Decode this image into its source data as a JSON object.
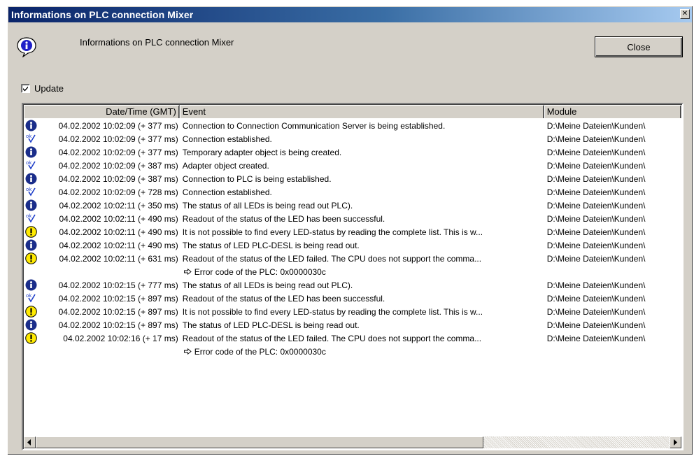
{
  "window": {
    "title": "Informations on PLC connection  Mixer"
  },
  "header": {
    "text": "Informations on PLC connection  Mixer",
    "close_label": "Close"
  },
  "update": {
    "label": "Update",
    "checked": true
  },
  "columns": [
    "Date/Time (GMT)",
    "Event",
    "Module"
  ],
  "rows": [
    {
      "icon": "info",
      "date": "04.02.2002 10:02:09 (+ 377 ms)",
      "event": "Connection to Connection Communication Server is being established.",
      "module": "D:\\Meine Dateien\\Kunden\\"
    },
    {
      "icon": "ok",
      "date": "04.02.2002 10:02:09 (+ 377 ms)",
      "event": "Connection established.",
      "module": "D:\\Meine Dateien\\Kunden\\"
    },
    {
      "icon": "info",
      "date": "04.02.2002 10:02:09 (+ 377 ms)",
      "event": "Temporary adapter object is being created.",
      "module": "D:\\Meine Dateien\\Kunden\\"
    },
    {
      "icon": "ok",
      "date": "04.02.2002 10:02:09 (+ 387 ms)",
      "event": "Adapter object created.",
      "module": "D:\\Meine Dateien\\Kunden\\"
    },
    {
      "icon": "info",
      "date": "04.02.2002 10:02:09 (+ 387 ms)",
      "event": "Connection to PLC is being established.",
      "module": "D:\\Meine Dateien\\Kunden\\"
    },
    {
      "icon": "ok",
      "date": "04.02.2002 10:02:09 (+ 728 ms)",
      "event": "Connection established.",
      "module": "D:\\Meine Dateien\\Kunden\\"
    },
    {
      "icon": "info",
      "date": "04.02.2002 10:02:11 (+ 350 ms)",
      "event": "The status of all LEDs is being read out PLC).",
      "module": "D:\\Meine Dateien\\Kunden\\"
    },
    {
      "icon": "ok",
      "date": "04.02.2002 10:02:11 (+ 490 ms)",
      "event": "Readout of the status of the LED has been successful.",
      "module": "D:\\Meine Dateien\\Kunden\\"
    },
    {
      "icon": "warn",
      "date": "04.02.2002 10:02:11 (+ 490 ms)",
      "event": "It is not possible to find every LED-status by reading the complete list. This is w...",
      "module": "D:\\Meine Dateien\\Kunden\\"
    },
    {
      "icon": "info",
      "date": "04.02.2002 10:02:11 (+ 490 ms)",
      "event": "The status of LED PLC-DESL is being read out.",
      "module": "D:\\Meine Dateien\\Kunden\\"
    },
    {
      "icon": "warn",
      "date": "04.02.2002 10:02:11 (+ 631 ms)",
      "event": "Readout of the status of the LED failed. The CPU does not support the comma...",
      "module": "D:\\Meine Dateien\\Kunden\\"
    },
    {
      "icon": "",
      "date": "",
      "event": "Error code of the PLC: 0x0000030c",
      "module": "",
      "sub": true
    },
    {
      "icon": "info",
      "date": "04.02.2002 10:02:15 (+ 777 ms)",
      "event": "The status of all LEDs is being read out PLC).",
      "module": "D:\\Meine Dateien\\Kunden\\"
    },
    {
      "icon": "ok",
      "date": "04.02.2002 10:02:15 (+ 897 ms)",
      "event": "Readout of the status of the LED has been successful.",
      "module": "D:\\Meine Dateien\\Kunden\\"
    },
    {
      "icon": "warn",
      "date": "04.02.2002 10:02:15 (+ 897 ms)",
      "event": "It is not possible to find every LED-status by reading the complete list. This is w...",
      "module": "D:\\Meine Dateien\\Kunden\\"
    },
    {
      "icon": "info",
      "date": "04.02.2002 10:02:15 (+ 897 ms)",
      "event": "The status of LED PLC-DESL is being read out.",
      "module": "D:\\Meine Dateien\\Kunden\\"
    },
    {
      "icon": "warn",
      "date": "04.02.2002 10:02:16 (+ 17 ms)",
      "event": "Readout of the status of the LED failed. The CPU does not support the comma...",
      "module": "D:\\Meine Dateien\\Kunden\\"
    },
    {
      "icon": "",
      "date": "",
      "event": "Error code of the PLC: 0x0000030c",
      "module": "",
      "sub": true
    }
  ]
}
